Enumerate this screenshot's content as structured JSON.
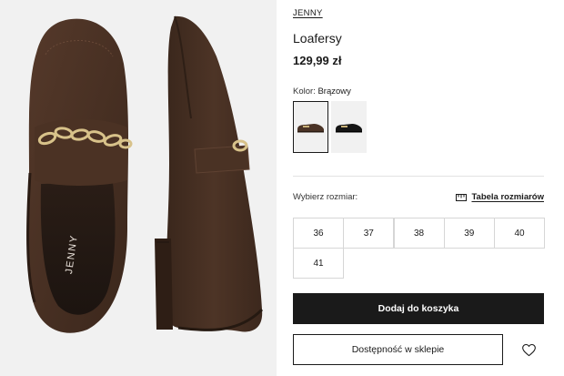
{
  "product": {
    "brand": "JENNY",
    "title": "Loafersy",
    "price": "129,99 zł",
    "insole_logo": "JENNY"
  },
  "color": {
    "label": "Kolor:",
    "value": "Brązowy",
    "swatches": [
      {
        "name": "brown",
        "hex": "#4a3326",
        "selected": true
      },
      {
        "name": "black",
        "hex": "#151515",
        "selected": false
      }
    ]
  },
  "sizes": {
    "label": "Wybierz rozmiar:",
    "chart_link": "Tabela rozmiarów",
    "chart_icon": "ruler-icon",
    "options": [
      "36",
      "37",
      "38",
      "39",
      "40",
      "41"
    ]
  },
  "actions": {
    "add_to_cart": "Dodaj do koszyka",
    "store_availability": "Dostępność w sklepie",
    "wishlist_icon": "heart-icon"
  },
  "colors": {
    "primary": "#1a1a1a",
    "shoe_brown": "#4a3326",
    "photo_bg": "#f1f1f1",
    "border": "#d6d6d6"
  }
}
